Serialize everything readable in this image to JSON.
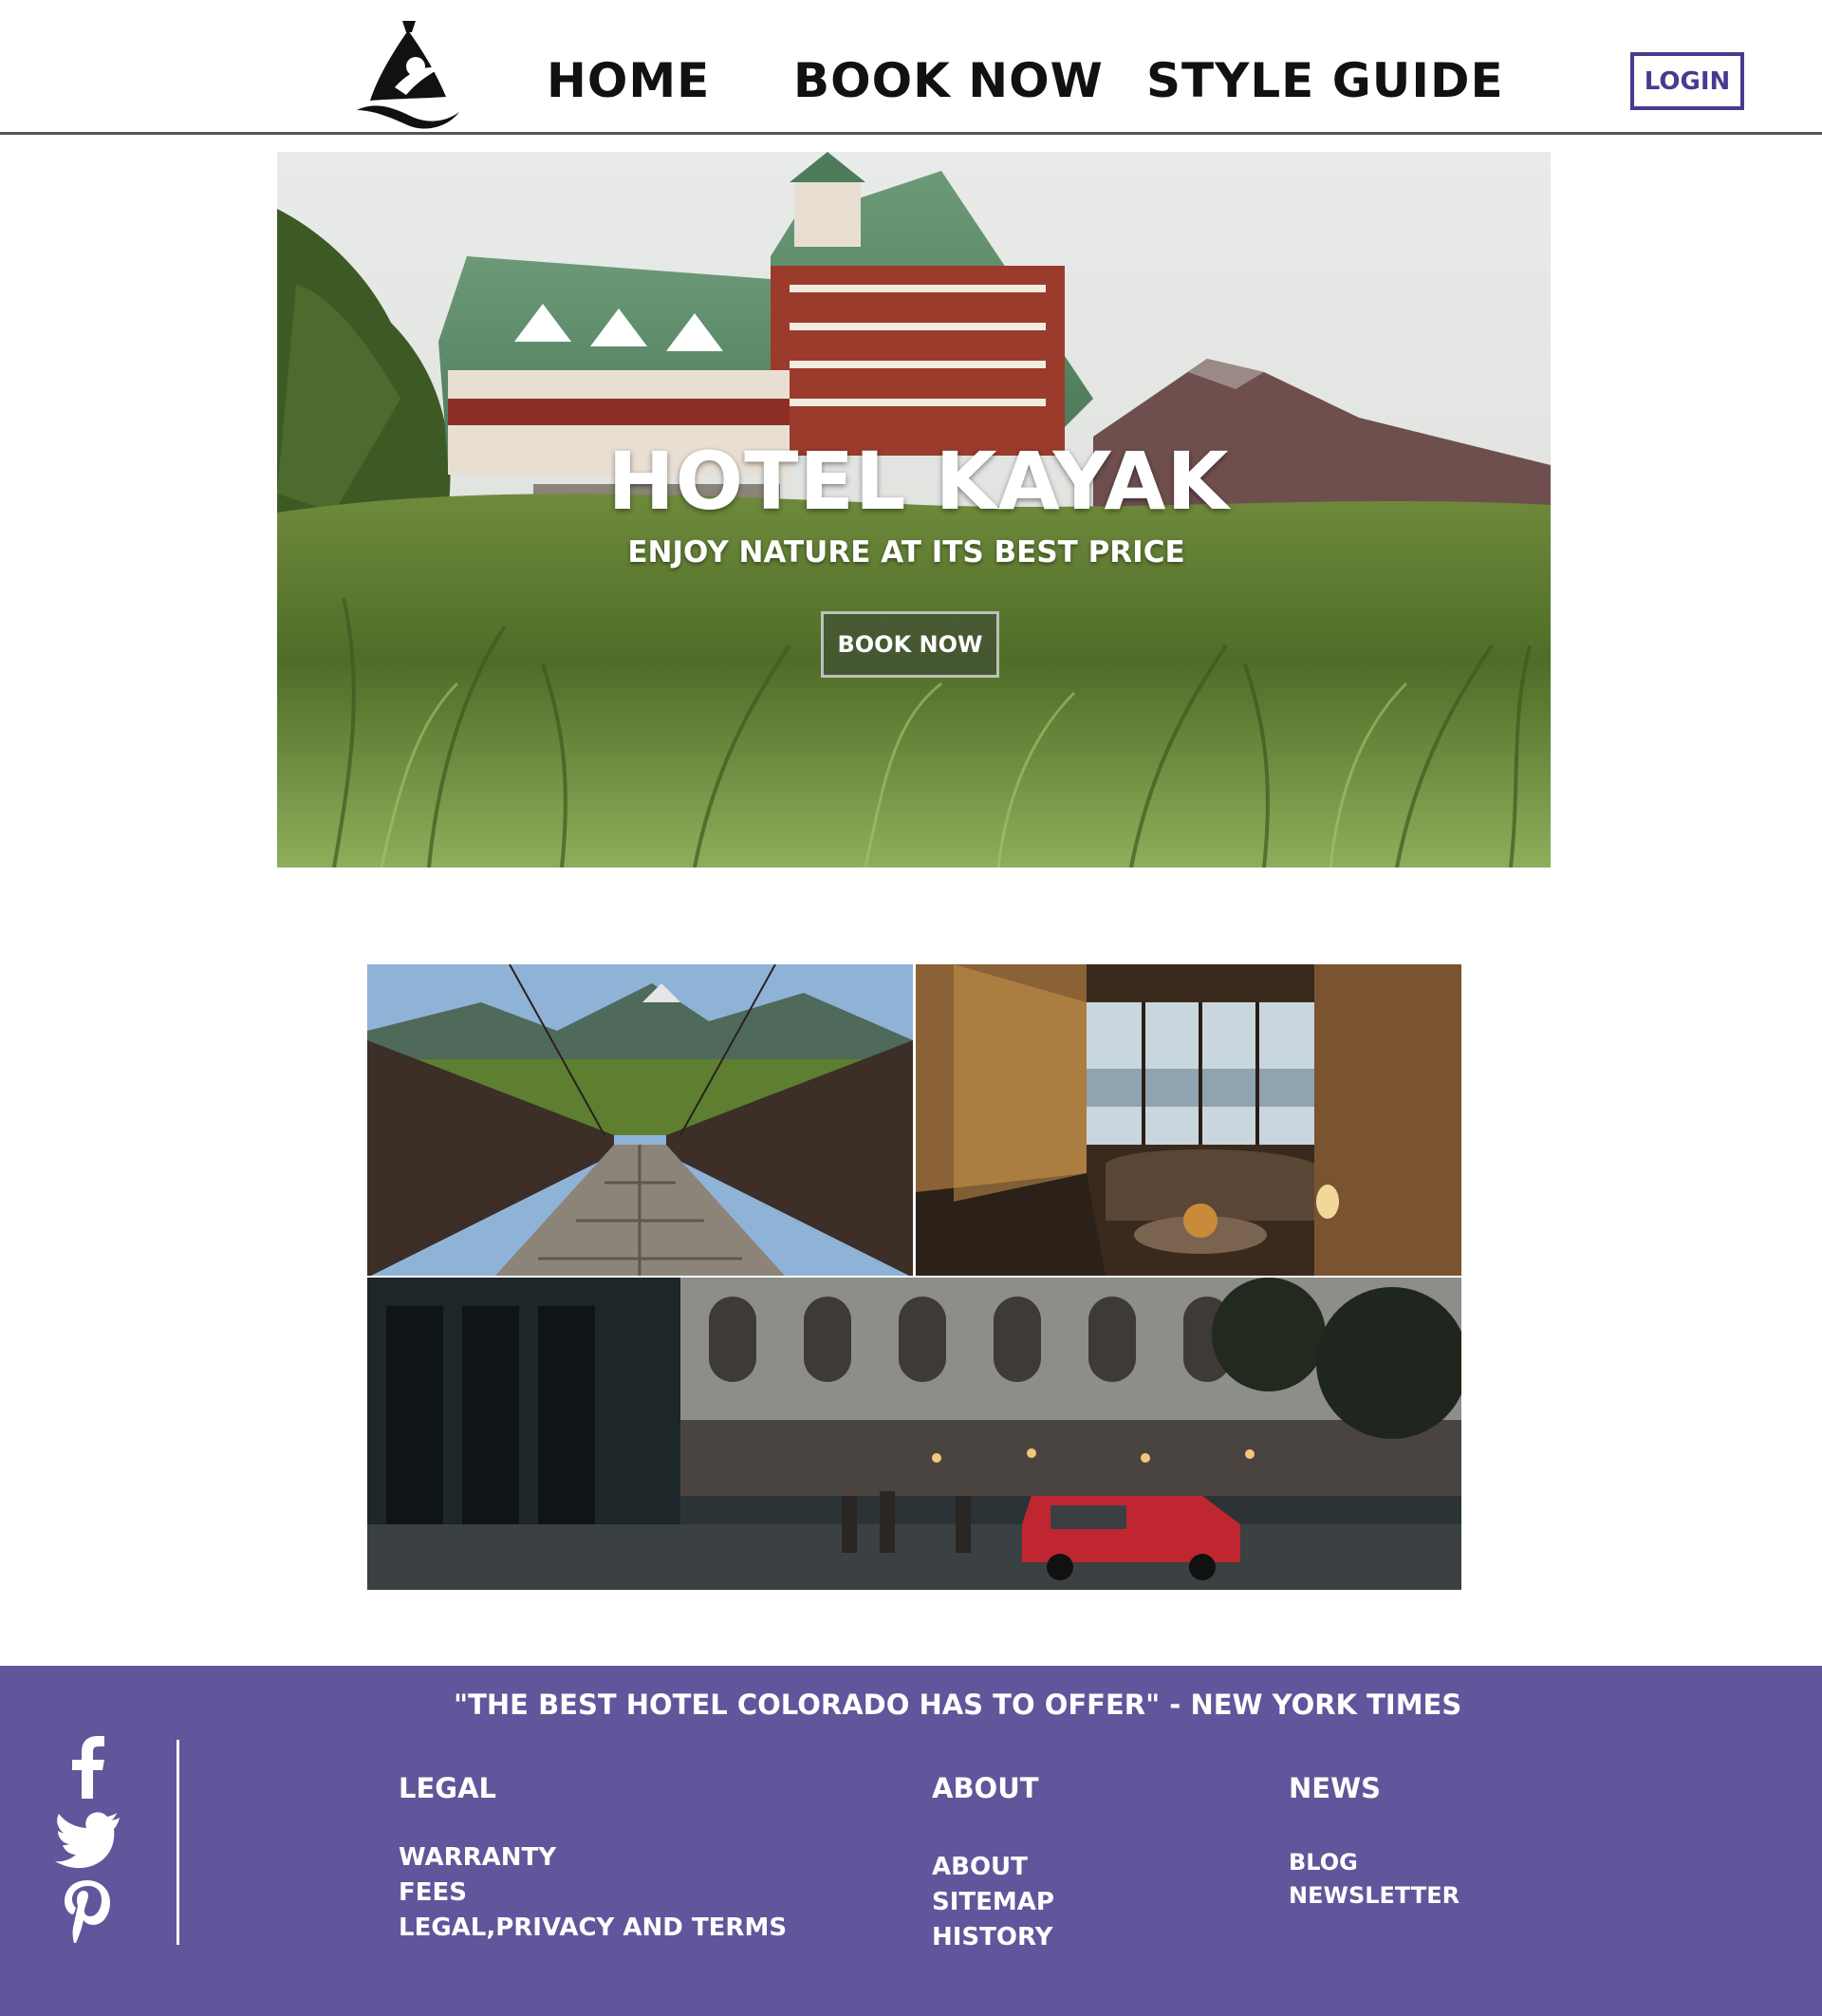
{
  "header": {
    "logo_icon": "kayaker-logo-icon",
    "nav": [
      {
        "label": "HOME"
      },
      {
        "label": "BOOK NOW"
      },
      {
        "label": "STYLE GUIDE"
      }
    ],
    "login_label": "LOGIN"
  },
  "hero": {
    "title": "HOTEL KAYAK",
    "subtitle": "ENJOY NATURE AT ITS BEST PRICE",
    "cta_label": "BOOK NOW"
  },
  "gallery": {
    "images": [
      "bridge-photo",
      "lounge-photo",
      "street-photo"
    ]
  },
  "footer": {
    "quote": "\"THE BEST HOTEL COLORADO HAS TO OFFER\" - NEW YORK TIMES",
    "social": [
      "facebook-icon",
      "twitter-icon",
      "pinterest-icon"
    ],
    "columns": [
      {
        "title": "LEGAL",
        "links": [
          "WARRANTY",
          "FEES",
          "LEGAL,PRIVACY AND TERMS"
        ]
      },
      {
        "title": "ABOUT",
        "links": [
          "ABOUT",
          "SITEMAP",
          "HISTORY"
        ]
      },
      {
        "title": "NEWS",
        "links": [
          "BLOG",
          "NEWSLETTER"
        ]
      }
    ]
  },
  "colors": {
    "footer_bg": "#62559b",
    "accent": "#4a3a8f",
    "header_border": "#555555"
  }
}
